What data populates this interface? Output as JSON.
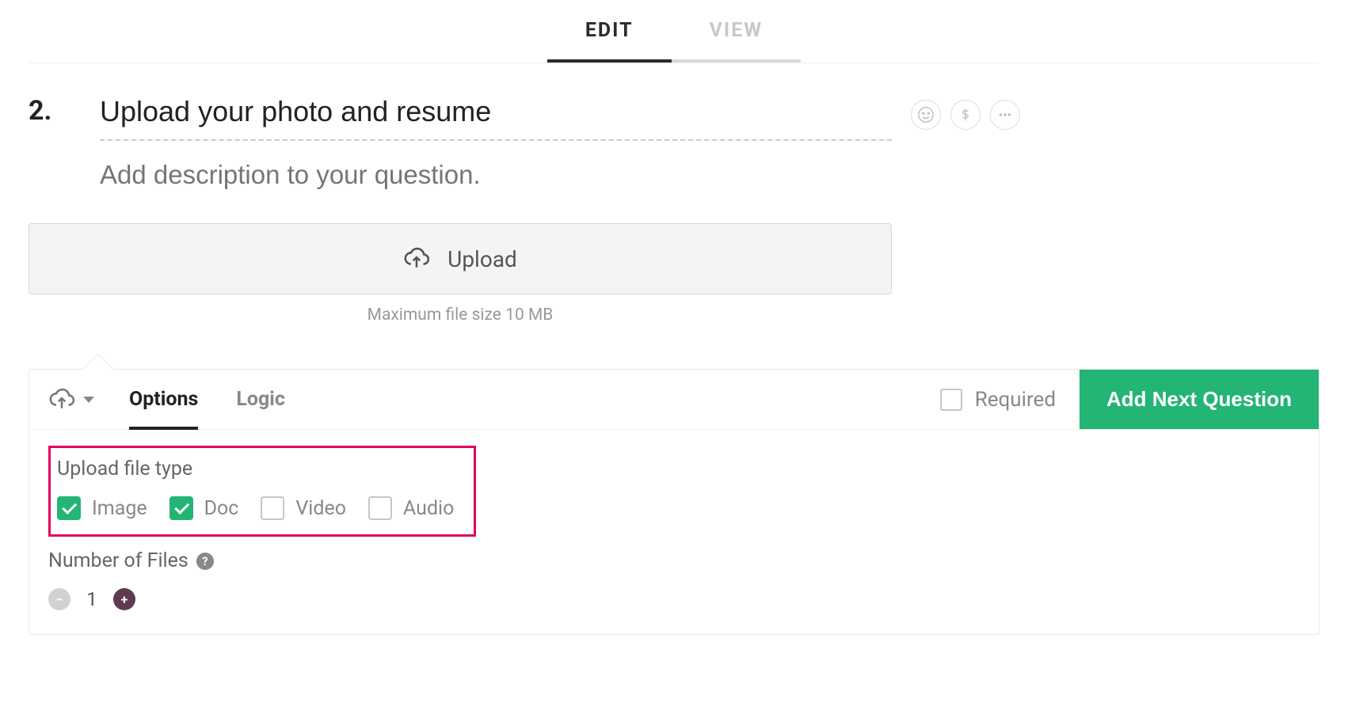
{
  "tabs": {
    "edit": "EDIT",
    "view": "VIEW"
  },
  "question": {
    "number": "2.",
    "title": "Upload your photo and resume",
    "description_placeholder": "Add description to your question."
  },
  "upload": {
    "button_label": "Upload",
    "note": "Maximum file size 10 MB"
  },
  "panel": {
    "tabs": {
      "options": "Options",
      "logic": "Logic"
    },
    "required_label": "Required",
    "add_next_label": "Add Next Question",
    "upload_file_type_title": "Upload file type",
    "file_types": [
      {
        "label": "Image",
        "checked": true
      },
      {
        "label": "Doc",
        "checked": true
      },
      {
        "label": "Video",
        "checked": false
      },
      {
        "label": "Audio",
        "checked": false
      }
    ],
    "number_of_files_label": "Number of Files",
    "help_glyph": "?",
    "file_count": "1",
    "minus_glyph": "−",
    "plus_glyph": "+"
  },
  "icons": {
    "smile": "smile-icon",
    "dollar": "dollar-icon",
    "more": "more-icon"
  }
}
